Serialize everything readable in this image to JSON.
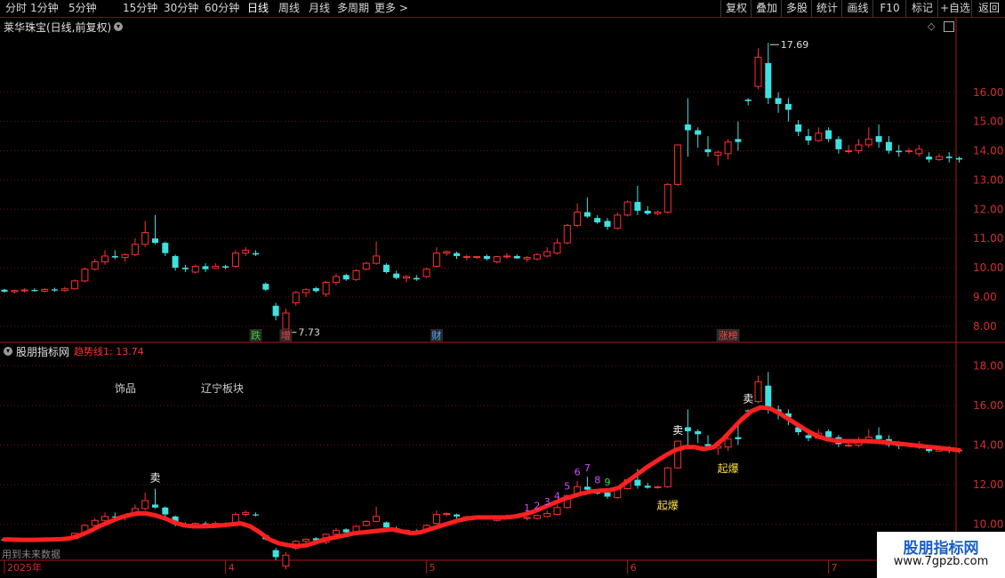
{
  "toolbar": {
    "periods": [
      "分时",
      "1分钟",
      "5分钟",
      "15分钟",
      "30分钟",
      "60分钟",
      "日线",
      "周线",
      "月线",
      "多周期",
      "更多 >"
    ],
    "active_period": "日线",
    "right_buttons": [
      "复权",
      "叠加",
      "多股",
      "统计",
      "画线",
      "F10",
      "标记",
      "+自选",
      "返回"
    ]
  },
  "main_panel": {
    "title": "莱华珠宝(日线,前复权)",
    "high_label": "17.69",
    "low_label": "7.73",
    "event_markers": [
      {
        "text": "跌",
        "color": "#35d035"
      },
      {
        "text": "增",
        "color": "#ff4040"
      },
      {
        "text": "财",
        "color": "#4fa3ff"
      },
      {
        "text": "涨榜",
        "color": "#ff4040"
      }
    ]
  },
  "indicator_panel": {
    "title": "股朋指标网",
    "trend_label": "趋势线1: 13.74",
    "tags": [
      {
        "text": "饰品",
        "color": "#ffffff"
      },
      {
        "text": "辽宁板块",
        "color": "#ff7a1a"
      }
    ],
    "signals": {
      "sell": "卖",
      "burst": "起爆",
      "counts": [
        "1",
        "2",
        "3",
        "4",
        "5",
        "6",
        "7",
        "8",
        "9"
      ]
    }
  },
  "footer": {
    "note": "用到未来数据"
  },
  "watermark": {
    "title": "股朋指标网",
    "url": "www.7gpzb.com"
  },
  "chart_data": [
    {
      "type": "candlestick",
      "title": "莱华珠宝(日线,前复权)",
      "xlabel": "",
      "ylabel": "",
      "ylim": [
        7.6,
        18.0
      ],
      "yticks": [
        8.0,
        9.0,
        10.0,
        11.0,
        12.0,
        13.0,
        14.0,
        15.0,
        16.0
      ],
      "x_month_labels": [
        {
          "index": 0,
          "label": "2025年"
        },
        {
          "index": 22,
          "label": "4"
        },
        {
          "index": 42,
          "label": "5"
        },
        {
          "index": 62,
          "label": "6"
        },
        {
          "index": 82,
          "label": "7"
        }
      ],
      "up_color": "#ff3030",
      "down_color": "#40e0e0",
      "ohlc": [
        [
          9.25,
          9.28,
          9.15,
          9.18
        ],
        [
          9.18,
          9.25,
          9.12,
          9.22
        ],
        [
          9.22,
          9.3,
          9.15,
          9.24
        ],
        [
          9.24,
          9.3,
          9.18,
          9.2
        ],
        [
          9.2,
          9.3,
          9.15,
          9.26
        ],
        [
          9.26,
          9.32,
          9.18,
          9.22
        ],
        [
          9.22,
          9.35,
          9.18,
          9.28
        ],
        [
          9.28,
          9.6,
          9.25,
          9.55
        ],
        [
          9.55,
          10.0,
          9.5,
          9.95
        ],
        [
          9.95,
          10.3,
          9.9,
          10.2
        ],
        [
          10.2,
          10.6,
          10.1,
          10.4
        ],
        [
          10.4,
          10.6,
          10.3,
          10.35
        ],
        [
          10.35,
          10.5,
          10.2,
          10.45
        ],
        [
          10.45,
          11.0,
          10.4,
          10.8
        ],
        [
          10.8,
          11.6,
          10.7,
          11.2
        ],
        [
          11.0,
          11.8,
          10.8,
          10.85
        ],
        [
          10.85,
          10.9,
          10.4,
          10.5
        ],
        [
          10.4,
          10.45,
          9.9,
          10.0
        ],
        [
          10.0,
          10.1,
          9.85,
          9.95
        ],
        [
          9.85,
          10.1,
          9.8,
          10.05
        ],
        [
          10.05,
          10.15,
          9.85,
          9.95
        ],
        [
          9.98,
          10.15,
          9.95,
          10.05
        ],
        [
          10.05,
          10.1,
          9.95,
          10.0
        ],
        [
          10.05,
          10.6,
          10.0,
          10.5
        ],
        [
          10.5,
          10.7,
          10.4,
          10.6
        ],
        [
          10.5,
          10.6,
          10.4,
          10.45
        ],
        [
          9.45,
          9.5,
          9.2,
          9.25
        ],
        [
          8.7,
          8.8,
          8.2,
          8.35
        ],
        [
          7.9,
          8.6,
          7.73,
          8.45
        ],
        [
          8.8,
          9.2,
          8.7,
          9.15
        ],
        [
          9.15,
          9.3,
          9.0,
          9.25
        ],
        [
          9.3,
          9.35,
          9.15,
          9.2
        ],
        [
          9.1,
          9.55,
          9.0,
          9.5
        ],
        [
          9.5,
          9.8,
          9.4,
          9.7
        ],
        [
          9.75,
          9.8,
          9.55,
          9.6
        ],
        [
          9.6,
          9.95,
          9.55,
          9.9
        ],
        [
          9.95,
          10.2,
          9.9,
          10.15
        ],
        [
          10.15,
          10.9,
          10.1,
          10.4
        ],
        [
          10.1,
          10.15,
          9.8,
          9.85
        ],
        [
          9.8,
          9.9,
          9.6,
          9.65
        ],
        [
          9.65,
          9.75,
          9.5,
          9.7
        ],
        [
          9.65,
          9.75,
          9.55,
          9.6
        ],
        [
          9.7,
          10.0,
          9.65,
          9.95
        ],
        [
          10.05,
          10.7,
          10.0,
          10.5
        ],
        [
          10.5,
          10.6,
          10.4,
          10.55
        ],
        [
          10.5,
          10.55,
          10.3,
          10.4
        ],
        [
          10.35,
          10.45,
          10.25,
          10.38
        ],
        [
          10.35,
          10.4,
          10.3,
          10.38
        ],
        [
          10.4,
          10.45,
          10.25,
          10.3
        ],
        [
          10.2,
          10.4,
          10.15,
          10.38
        ],
        [
          10.38,
          10.5,
          10.3,
          10.4
        ],
        [
          10.4,
          10.45,
          10.3,
          10.32
        ],
        [
          10.3,
          10.4,
          10.2,
          10.35
        ],
        [
          10.3,
          10.5,
          10.25,
          10.45
        ],
        [
          10.4,
          10.7,
          10.35,
          10.55
        ],
        [
          10.5,
          11.0,
          10.45,
          10.85
        ],
        [
          10.85,
          11.5,
          10.8,
          11.45
        ],
        [
          11.45,
          12.2,
          11.4,
          11.9
        ],
        [
          11.9,
          12.4,
          11.7,
          11.75
        ],
        [
          11.7,
          11.8,
          11.5,
          11.55
        ],
        [
          11.6,
          11.7,
          11.3,
          11.4
        ],
        [
          11.35,
          11.9,
          11.3,
          11.8
        ],
        [
          11.8,
          12.3,
          11.75,
          12.25
        ],
        [
          12.25,
          12.8,
          11.8,
          11.95
        ],
        [
          11.95,
          12.1,
          11.8,
          11.85
        ],
        [
          11.85,
          11.95,
          11.8,
          11.9
        ],
        [
          11.9,
          12.9,
          11.85,
          12.85
        ],
        [
          12.85,
          14.2,
          12.8,
          14.2
        ],
        [
          14.9,
          15.8,
          13.8,
          14.7
        ],
        [
          14.7,
          14.8,
          14.1,
          14.55
        ],
        [
          14.05,
          14.5,
          13.8,
          13.95
        ],
        [
          13.85,
          14.0,
          13.5,
          13.95
        ],
        [
          13.9,
          14.4,
          13.7,
          14.3
        ],
        [
          14.4,
          15.0,
          14.0,
          14.3
        ],
        [
          15.75,
          15.8,
          15.55,
          15.7
        ],
        [
          16.2,
          17.5,
          16.1,
          17.2
        ],
        [
          17.0,
          17.69,
          15.6,
          15.8
        ],
        [
          15.8,
          16.0,
          15.3,
          15.6
        ],
        [
          15.6,
          15.8,
          15.0,
          15.4
        ],
        [
          14.9,
          15.05,
          14.5,
          14.65
        ],
        [
          14.5,
          14.75,
          14.2,
          14.35
        ],
        [
          14.35,
          14.8,
          14.3,
          14.6
        ],
        [
          14.7,
          14.8,
          14.3,
          14.4
        ],
        [
          14.4,
          14.5,
          13.9,
          14.05
        ],
        [
          14.0,
          14.2,
          13.9,
          14.0
        ],
        [
          14.0,
          14.4,
          13.9,
          14.2
        ],
        [
          14.2,
          14.8,
          14.1,
          14.4
        ],
        [
          14.5,
          14.9,
          14.1,
          14.3
        ],
        [
          14.3,
          14.5,
          13.9,
          14.0
        ],
        [
          14.0,
          14.2,
          13.8,
          13.95
        ],
        [
          14.0,
          14.1,
          13.9,
          14.0
        ],
        [
          13.9,
          14.2,
          13.8,
          14.05
        ],
        [
          13.8,
          13.95,
          13.6,
          13.7
        ],
        [
          13.7,
          13.9,
          13.65,
          13.8
        ],
        [
          13.8,
          13.95,
          13.6,
          13.75
        ],
        [
          13.75,
          13.8,
          13.6,
          13.7
        ]
      ]
    },
    {
      "type": "line",
      "title": "股朋指标网",
      "xlabel": "",
      "ylabel": "",
      "ylim": [
        9.0,
        18.6
      ],
      "yticks": [
        10.0,
        12.0,
        14.0,
        16.0,
        18.0
      ],
      "series": [
        {
          "name": "趋势线1",
          "color": "#ff2020",
          "values": [
            9.24,
            9.23,
            9.22,
            9.22,
            9.23,
            9.24,
            9.25,
            9.3,
            9.45,
            9.65,
            9.9,
            10.1,
            10.3,
            10.45,
            10.55,
            10.55,
            10.45,
            10.3,
            10.1,
            9.95,
            9.9,
            9.9,
            9.92,
            9.95,
            10.0,
            10.05,
            9.9,
            9.6,
            9.25,
            9.05,
            8.95,
            8.9,
            8.95,
            9.1,
            9.25,
            9.35,
            9.45,
            9.55,
            9.6,
            9.65,
            9.7,
            9.75,
            9.65,
            9.55,
            9.6,
            9.75,
            9.9,
            10.05,
            10.2,
            10.3,
            10.35,
            10.35,
            10.35,
            10.35,
            10.4,
            10.5,
            10.65,
            10.85,
            11.05,
            11.25,
            11.4,
            11.55,
            11.65,
            11.7,
            11.72,
            11.85,
            12.2,
            12.55,
            12.9,
            13.2,
            13.5,
            13.75,
            13.9,
            13.9,
            13.8,
            13.9,
            14.3,
            14.8,
            15.3,
            15.7,
            15.9,
            15.85,
            15.6,
            15.3,
            15.0,
            14.7,
            14.45,
            14.3,
            14.22,
            14.2,
            14.2,
            14.2,
            14.18,
            14.15,
            14.1,
            14.05,
            14.0,
            13.95,
            13.9,
            13.85,
            13.8,
            13.74
          ]
        }
      ]
    }
  ]
}
